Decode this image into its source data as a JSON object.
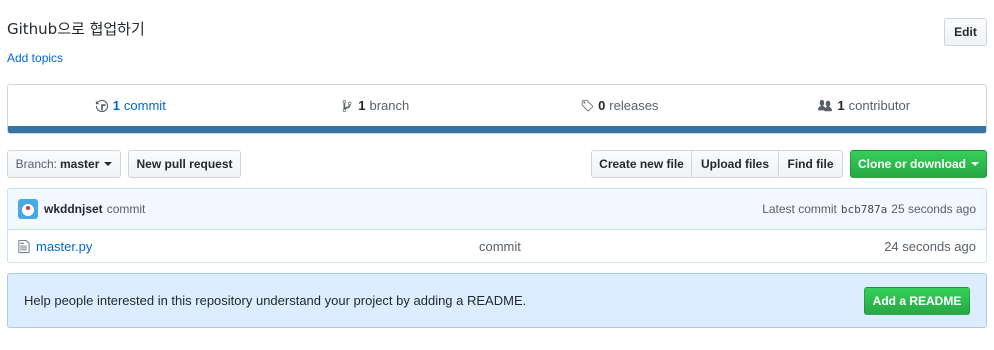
{
  "repo": {
    "description": "Github으로 협업하기",
    "add_topics": "Add topics",
    "edit_label": "Edit"
  },
  "summary": {
    "commits": {
      "count": "1",
      "label": "commit",
      "icon": "history-icon"
    },
    "branches": {
      "count": "1",
      "label": "branch",
      "icon": "git-branch-icon"
    },
    "releases": {
      "count": "0",
      "label": "releases",
      "icon": "tag-icon"
    },
    "contributors": {
      "count": "1",
      "label": "contributor",
      "icon": "people-icon"
    },
    "language_color": "#3572a5"
  },
  "toolbar": {
    "branch_prefix": "Branch:",
    "branch_name": "master",
    "new_pull_request": "New pull request",
    "create_new_file": "Create new file",
    "upload_files": "Upload files",
    "find_file": "Find file",
    "clone_or_download": "Clone or download"
  },
  "latest_commit": {
    "author": "wkddnjset",
    "message": "commit",
    "prefix": "Latest commit",
    "sha": "bcb787a",
    "age": "25 seconds ago"
  },
  "files": [
    {
      "name": "master.py",
      "message": "commit",
      "age": "24 seconds ago",
      "icon": "file-icon"
    }
  ],
  "readme_prompt": {
    "text": "Help people interested in this repository understand your project by adding a README.",
    "button": "Add a README"
  },
  "colors": {
    "link": "#0366d6",
    "primary_button": "#28a745",
    "readme_background": "#dbedff"
  }
}
